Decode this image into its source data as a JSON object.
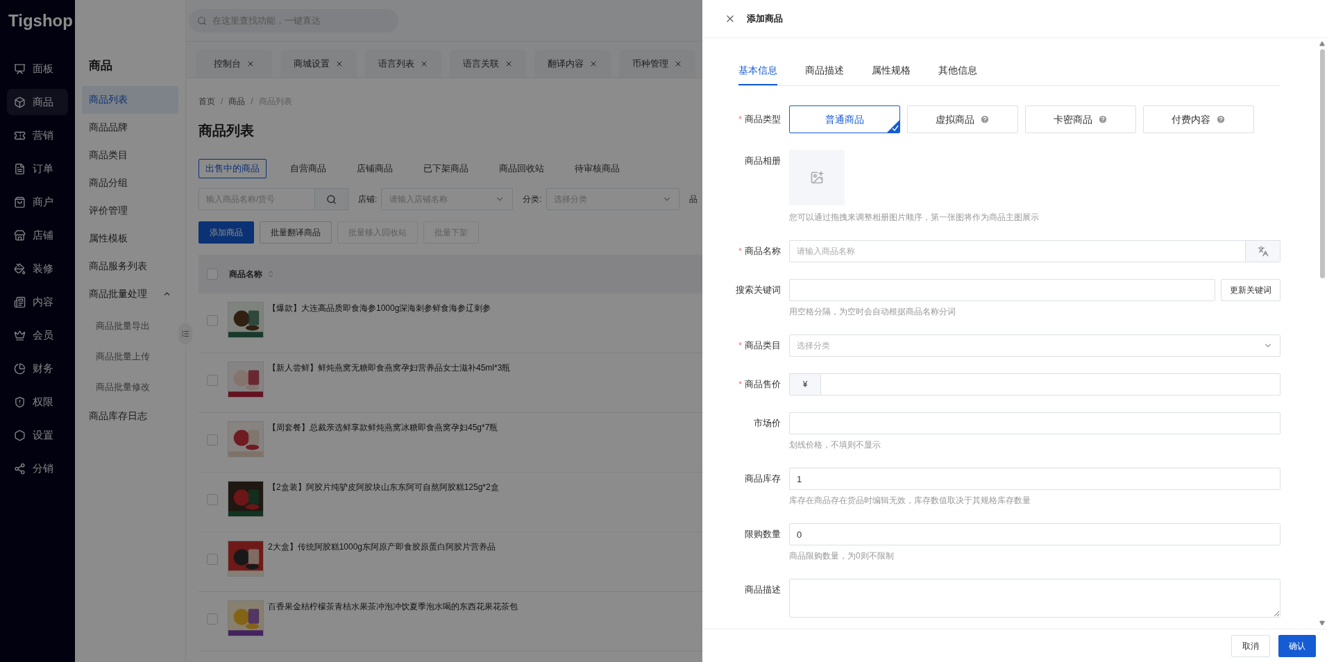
{
  "brand": "Tigshop",
  "search": {
    "placeholder": "在这里查找功能，一键直达"
  },
  "nav": [
    {
      "label": "面板",
      "selected": false
    },
    {
      "label": "商品",
      "selected": true
    },
    {
      "label": "营销",
      "selected": false
    },
    {
      "label": "订单",
      "selected": false
    },
    {
      "label": "商户",
      "selected": false
    },
    {
      "label": "店铺",
      "selected": false
    },
    {
      "label": "装修",
      "selected": false
    },
    {
      "label": "内容",
      "selected": false
    },
    {
      "label": "会员",
      "selected": false
    },
    {
      "label": "财务",
      "selected": false
    },
    {
      "label": "权限",
      "selected": false
    },
    {
      "label": "设置",
      "selected": false
    },
    {
      "label": "分销",
      "selected": false
    }
  ],
  "submenu": {
    "title": "商品",
    "items": [
      {
        "label": "商品列表",
        "selected": true
      },
      {
        "label": "商品品牌",
        "selected": false
      },
      {
        "label": "商品类目",
        "selected": false
      },
      {
        "label": "商品分组",
        "selected": false
      },
      {
        "label": "评价管理",
        "selected": false
      },
      {
        "label": "属性模板",
        "selected": false
      },
      {
        "label": "商品服务列表",
        "selected": false
      },
      {
        "label": "商品批量处理",
        "selected": false,
        "expanded": true,
        "children": [
          {
            "label": "商品批量导出",
            "selected": false
          },
          {
            "label": "商品批量上传",
            "selected": false
          },
          {
            "label": "商品批量修改",
            "selected": false
          }
        ]
      },
      {
        "label": "商品库存日志",
        "selected": false
      }
    ]
  },
  "page_tabs": [
    "控制台",
    "商城设置",
    "语言列表",
    "语言关联",
    "翻译内容",
    "币种管理"
  ],
  "breadcrumb": [
    "首页",
    "商品",
    "商品列表"
  ],
  "breadcrumb_separator": "/",
  "page_title": "商品列表",
  "filter_tabs": [
    {
      "label": "出售中的商品",
      "selected": true
    },
    {
      "label": "自营商品",
      "selected": false
    },
    {
      "label": "店铺商品",
      "selected": false
    },
    {
      "label": "已下架商品",
      "selected": false
    },
    {
      "label": "商品回收站",
      "selected": false
    },
    {
      "label": "待审核商品",
      "selected": false
    }
  ],
  "filters": {
    "keyword_placeholder": "输入商品名称/货号",
    "shop_label": "店铺:",
    "shop_placeholder": "请输入店铺名称",
    "category_label": "分类:",
    "category_placeholder": "选择分类",
    "column_5": "品"
  },
  "actions": [
    {
      "label": "添加商品",
      "kind": "primary",
      "disabled": false
    },
    {
      "label": "批量翻译商品",
      "kind": "default",
      "disabled": false
    },
    {
      "label": "批量移入回收站",
      "kind": "default",
      "disabled": true
    },
    {
      "label": "批量下架",
      "kind": "default",
      "disabled": true
    }
  ],
  "table": {
    "columns": [
      "商品名称"
    ],
    "header_checked": false,
    "rows": [
      {
        "name": "【爆款】大连高品质即食海参1000g深海刺参鲜食海参辽刺参",
        "checked": false
      },
      {
        "name": "【新人尝鲜】鲜炖燕窝无糖即食燕窝孕妇营养品女士滋补45ml*3瓶",
        "checked": false
      },
      {
        "name": "【周套餐】总裁亲选鲜享款鲜炖燕窝冰糖即食燕窝孕妇45g*7瓶",
        "checked": false
      },
      {
        "name": "【2盒装】阿胶片纯驴皮阿胶块山东东阿可自熬阿胶糕125g*2盒",
        "checked": false
      },
      {
        "name": "2大盒】传统阿胶糕1000g东阿原产即食胶原蛋白阿胶片营养品",
        "checked": false
      },
      {
        "name": "百香果金桔柠檬茶青桔水果茶冲泡冲饮夏季泡水喝的东西花果花茶包",
        "checked": false
      }
    ]
  },
  "drawer": {
    "title": "添加商品",
    "required_mark": "*",
    "tabs": [
      {
        "label": "基本信息",
        "selected": true
      },
      {
        "label": "商品描述",
        "selected": false
      },
      {
        "label": "属性规格",
        "selected": false
      },
      {
        "label": "其他信息",
        "selected": false
      }
    ],
    "fields": [
      {
        "kind": "options",
        "label": "商品类型",
        "required": true,
        "options": [
          {
            "label": "普通商品",
            "selected": true,
            "help": false
          },
          {
            "label": "虚拟商品",
            "selected": false,
            "help": true
          },
          {
            "label": "卡密商品",
            "selected": false,
            "help": true
          },
          {
            "label": "付费内容",
            "selected": false,
            "help": true
          }
        ]
      },
      {
        "kind": "album",
        "label": "商品相册",
        "required": false,
        "hint": "您可以通过拖拽来调整相册图片顺序，第一张图将作为商品主图展示"
      },
      {
        "kind": "input_icon",
        "label": "商品名称",
        "required": true,
        "placeholder": "请输入商品名称"
      },
      {
        "kind": "input_button",
        "label": "搜索关键词",
        "required": false,
        "button": "更新关键词",
        "hint": "用空格分隔，为空时会自动根据商品名称分词"
      },
      {
        "kind": "select",
        "label": "商品类目",
        "required": true,
        "placeholder": "选择分类"
      },
      {
        "kind": "price",
        "label": "商品售价",
        "required": true,
        "prefix": "¥"
      },
      {
        "kind": "input",
        "label": "市场价",
        "required": false,
        "hint": "划线价格，不填则不显示"
      },
      {
        "kind": "input",
        "label": "商品库存",
        "required": false,
        "value": "1",
        "hint": "库存在商品存在货品时编辑无效，库存数值取决于其规格库存数量"
      },
      {
        "kind": "input",
        "label": "限购数量",
        "required": false,
        "value": "0",
        "hint": "商品限购数量，为0则不限制"
      },
      {
        "kind": "textarea",
        "label": "商品描述",
        "required": false
      }
    ],
    "cancel": "取消",
    "confirm": "确认"
  }
}
